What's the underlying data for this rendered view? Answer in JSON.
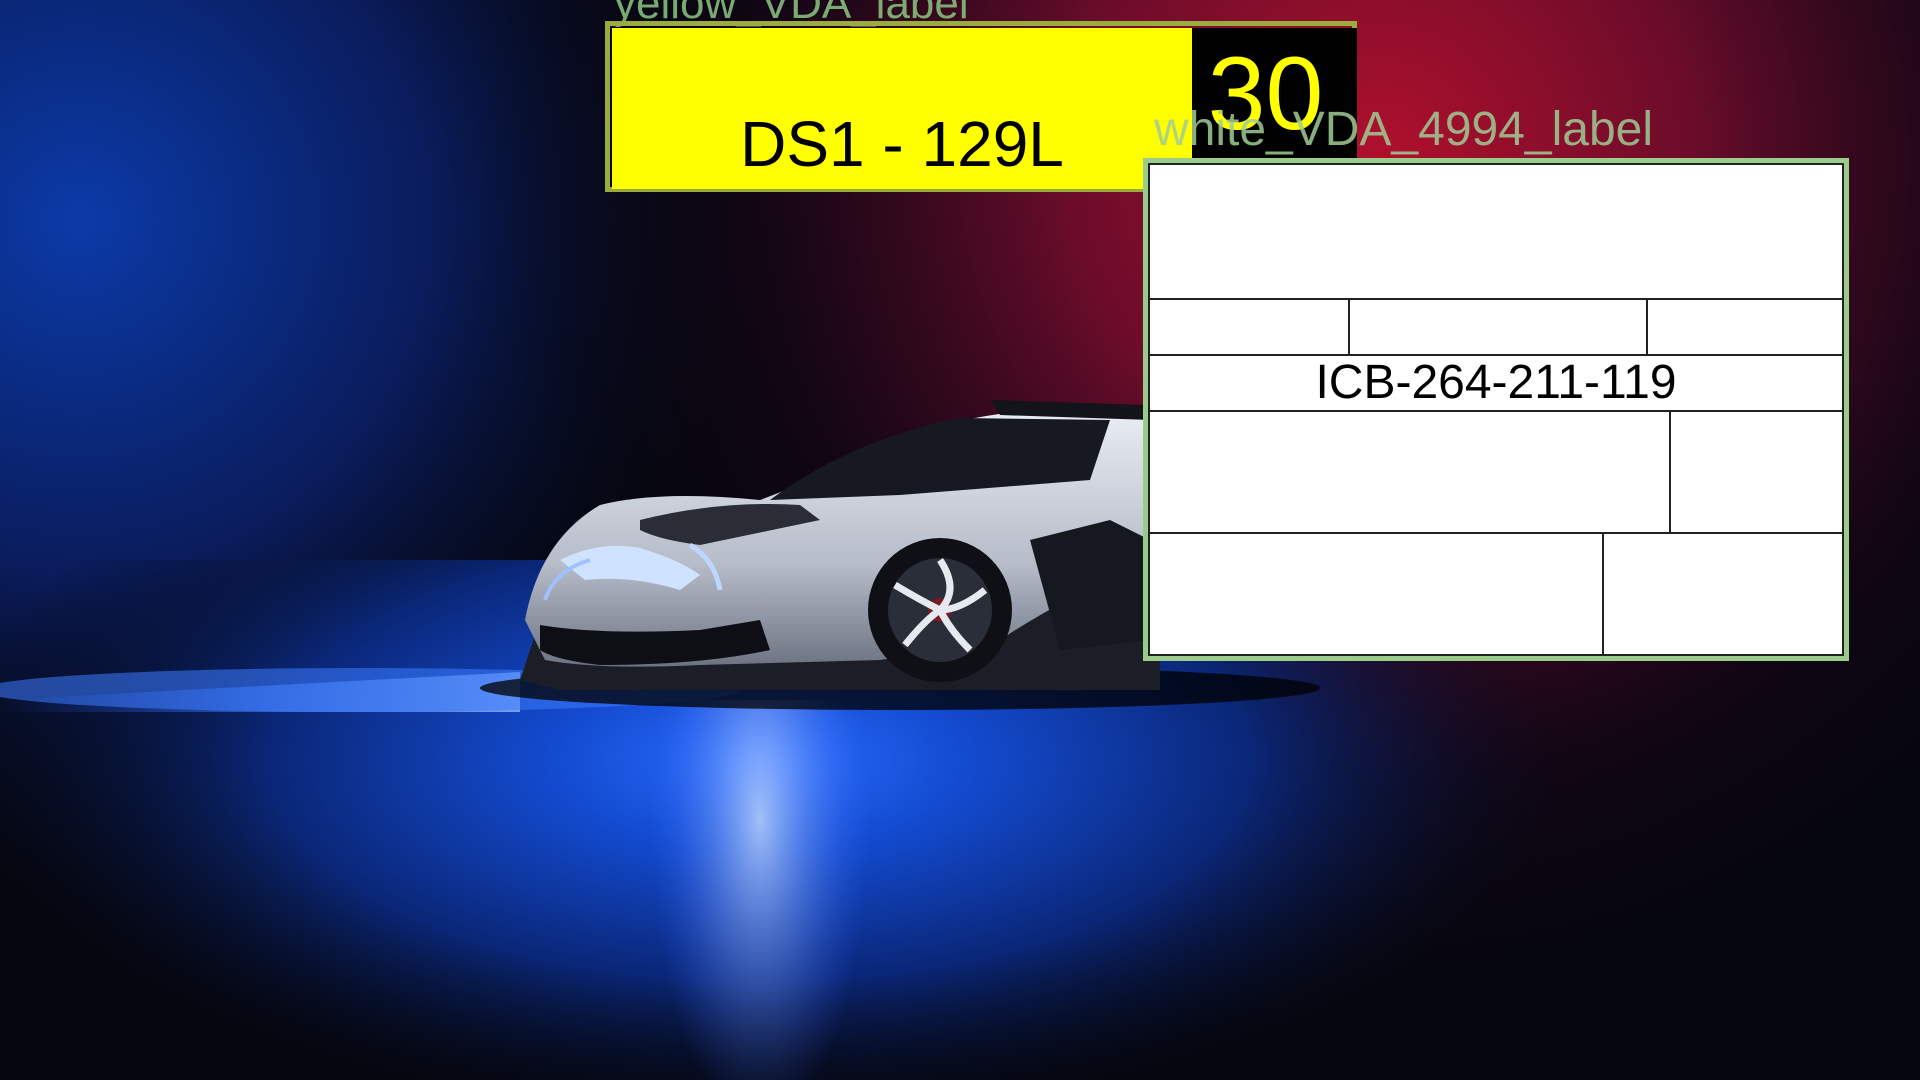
{
  "yellow_label": {
    "caption": "yellow_VDA_label",
    "code": "DS1 - 129L",
    "number": "30"
  },
  "white_label": {
    "caption": "white_VDA_4994_label",
    "code": "ICB-264-211-119"
  },
  "colors": {
    "yellow": "#ffff00",
    "frame_yellow": "#9aab3f",
    "frame_green": "#9ccc8c",
    "background_blue": "#1040c0",
    "background_red": "#a0102a"
  }
}
